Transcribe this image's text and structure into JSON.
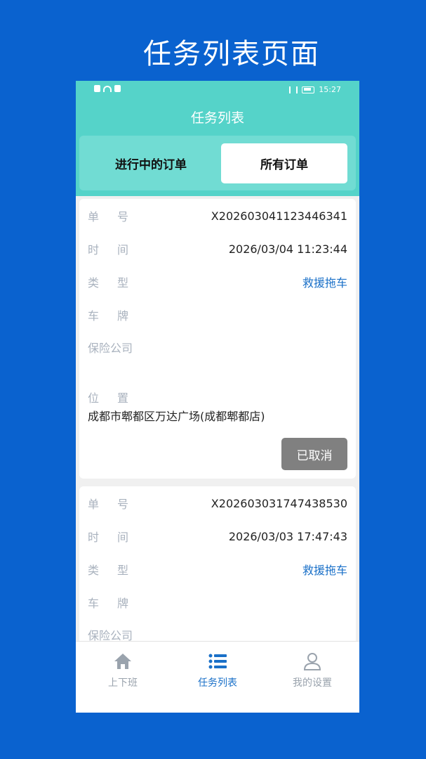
{
  "page_title": "任务列表页面",
  "statusbar": {
    "time": "15:27"
  },
  "header": {
    "title": "任务列表"
  },
  "segments": {
    "left": "进行中的订单",
    "right": "所有订单"
  },
  "labels": {
    "order_no": "单号",
    "time": "时间",
    "type": "类型",
    "plate": "车牌",
    "insurer": "保险公司",
    "location": "位置"
  },
  "orders": [
    {
      "order_no": "X202603041123446341",
      "time": "2026/03/04 11:23:44",
      "type": "救援拖车",
      "plate": "",
      "insurer": "",
      "address": "成都市郫都区万达广场(成都郫都店)",
      "status": "已取消"
    },
    {
      "order_no": "X202603031747438530",
      "time": "2026/03/03 17:47:43",
      "type": "救援拖车",
      "plate": "",
      "insurer": "保险公司"
    }
  ],
  "tabbar": {
    "tab1": "上下班",
    "tab2": "任务列表",
    "tab3": "我的设置"
  },
  "colors": {
    "background": "#0a62cf",
    "header": "#55d3c9",
    "accent": "#1a70c8",
    "cancel": "#808080"
  }
}
